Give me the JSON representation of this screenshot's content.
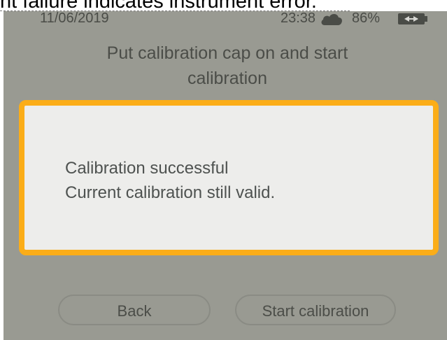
{
  "caption": {
    "text": "nt failure indicates instrument error."
  },
  "status_bar": {
    "date": "11/06/2019",
    "time": "23:38",
    "weather_icon": "cloud-icon",
    "battery_percent": "86%",
    "battery_icon": "battery-charging-icon"
  },
  "instruction": {
    "line1": "Put calibration cap on and start",
    "line2": "calibration"
  },
  "dialog": {
    "line1": "Calibration successful",
    "line2": "Current calibration still valid.",
    "border_color": "#fbad18"
  },
  "buttons": {
    "back_label": "Back",
    "start_label": "Start calibration"
  },
  "colors": {
    "screen_bg": "#999a92",
    "dialog_bg": "#ededeb",
    "accent": "#fbad18"
  }
}
